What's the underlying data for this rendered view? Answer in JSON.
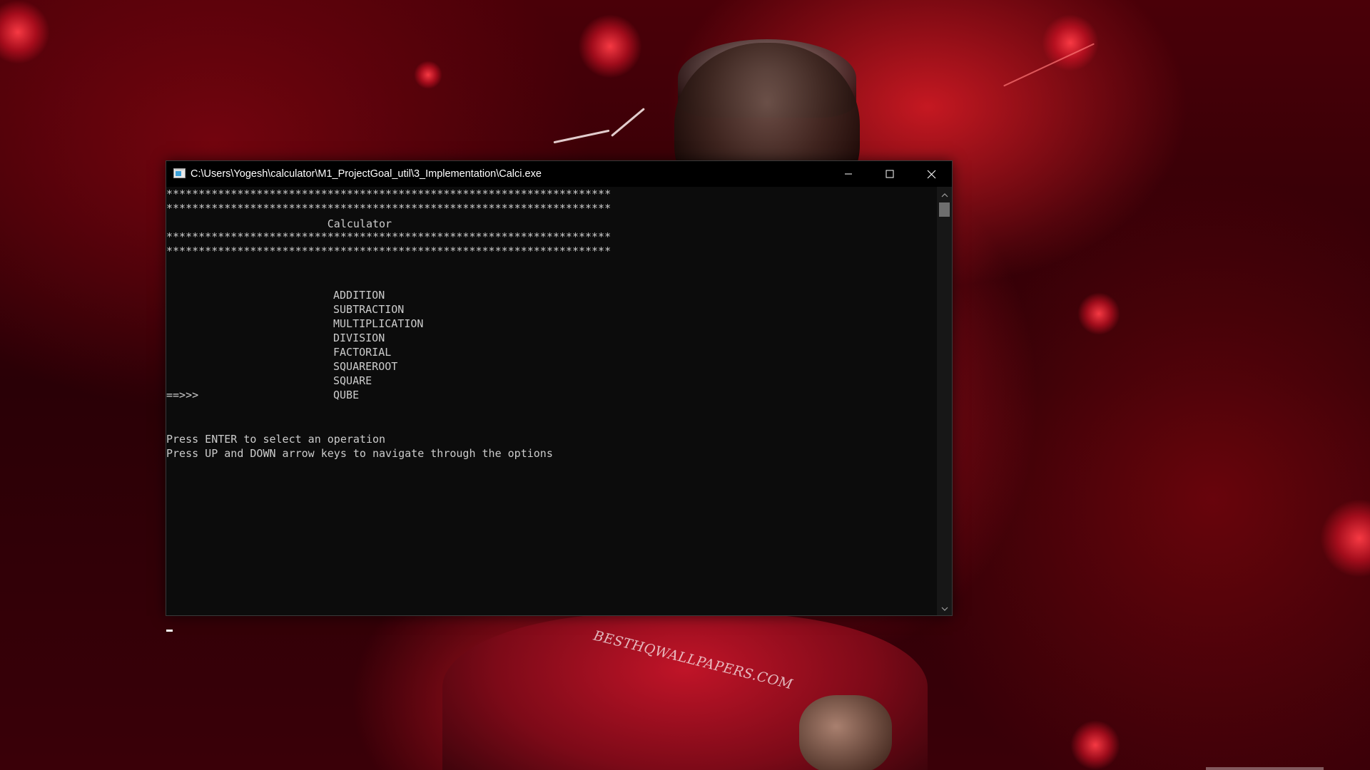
{
  "window": {
    "title": "C:\\Users\\Yogesh\\calculator\\M1_ProjectGoal_util\\3_Implementation\\Calci.exe",
    "controls": {
      "minimize_icon": "minimize-icon",
      "maximize_icon": "maximize-icon",
      "close_icon": "close-icon"
    }
  },
  "console": {
    "banner_line_1": "*********************************************************************",
    "banner_line_2": "*********************************************************************",
    "heading": "                         Calculator",
    "banner_line_3": "*********************************************************************",
    "banner_line_4": "*********************************************************************",
    "menu_indent": "                         ",
    "menu_items": [
      "ADDITION",
      "SUBTRACTION",
      "MULTIPLICATION",
      "DIVISION",
      "FACTORIAL",
      "SQUAREROOT",
      "SQUARE",
      "QUBE"
    ],
    "selected_index": 7,
    "selector_marker": "==>>>",
    "help_enter": "Press ENTER to select an operation",
    "help_arrows": "Press UP and DOWN arrow keys to navigate through the options"
  },
  "wallpaper": {
    "watermark": "BESTHQWALLPAPERS.COM",
    "accent_color": "#c8102e"
  },
  "colors": {
    "console_bg": "#0c0c0c",
    "console_fg": "#cccccc",
    "titlebar_bg": "#000000"
  }
}
